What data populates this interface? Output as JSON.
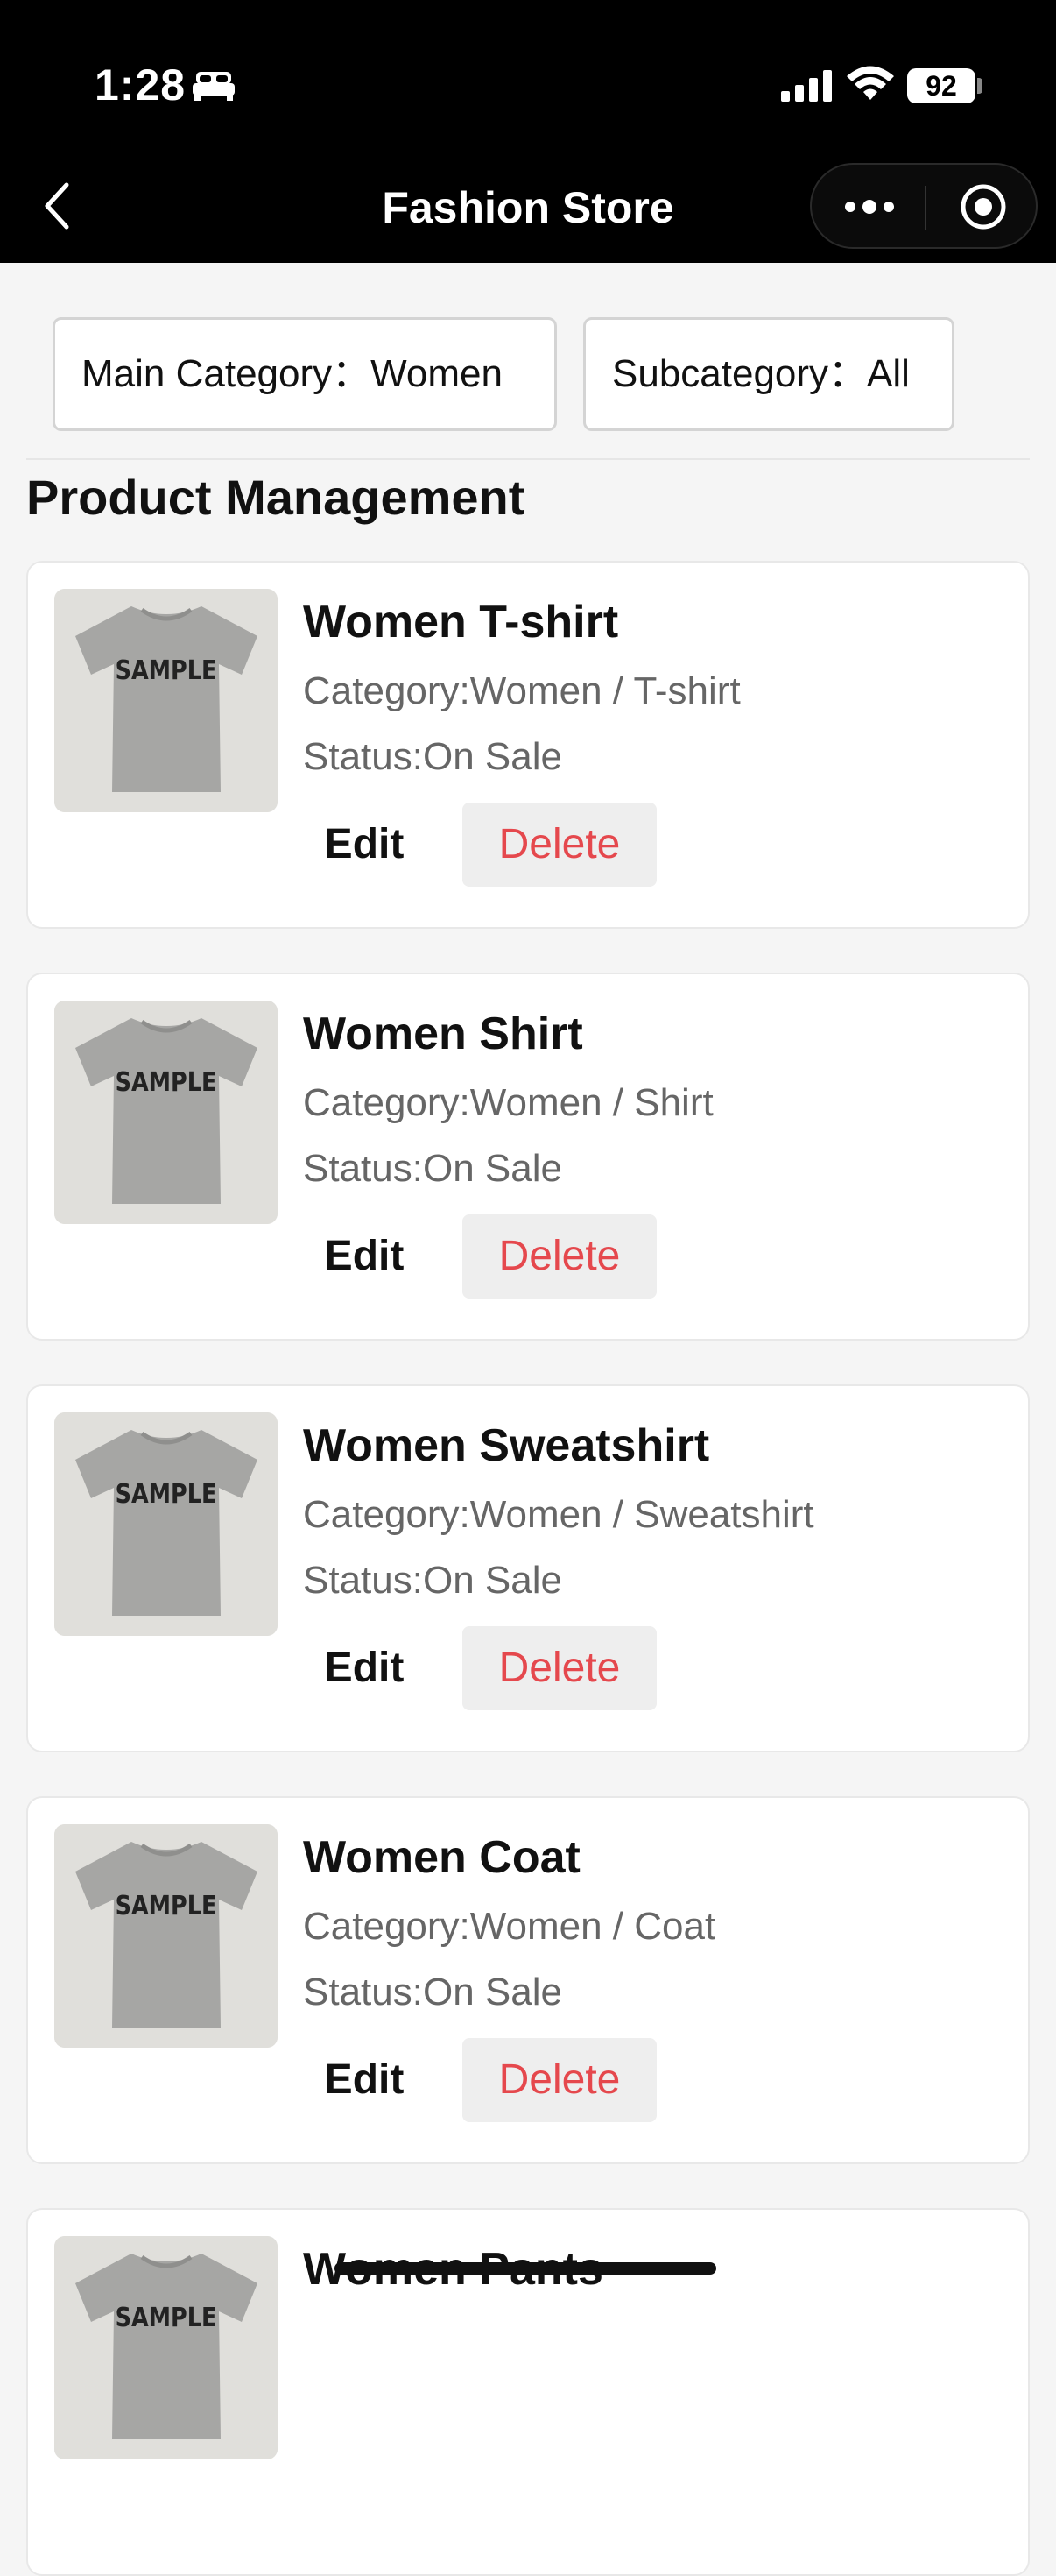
{
  "status_bar": {
    "time": "1:28",
    "battery": "92"
  },
  "nav": {
    "title": "Fashion Store"
  },
  "filters": {
    "main_category": "Main Category：Women",
    "subcategory": "Subcategory：All"
  },
  "section": {
    "title": "Product Management"
  },
  "products": [
    {
      "name": "Women T-shirt",
      "category": "Category:Women / T-shirt",
      "status": "Status:On Sale",
      "thumb_text": "SAMPLE"
    },
    {
      "name": "Women Shirt",
      "category": "Category:Women / Shirt",
      "status": "Status:On Sale",
      "thumb_text": "SAMPLE"
    },
    {
      "name": "Women Sweatshirt",
      "category": "Category:Women / Sweatshirt",
      "status": "Status:On Sale",
      "thumb_text": "SAMPLE"
    },
    {
      "name": "Women Coat",
      "category": "Category:Women / Coat",
      "status": "Status:On Sale",
      "thumb_text": "SAMPLE"
    },
    {
      "name": "Women Pants",
      "thumb_text": "SAMPLE"
    }
  ],
  "actions": {
    "edit_label": "Edit",
    "delete_label": "Delete"
  },
  "colors": {
    "delete_text": "#e5484d",
    "header_bg": "#000000"
  }
}
